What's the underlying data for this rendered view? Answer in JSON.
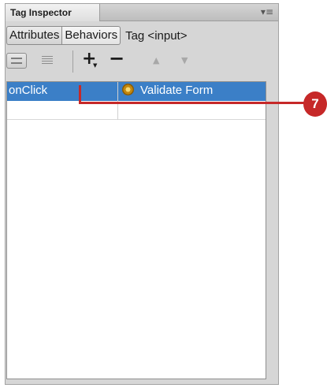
{
  "panel": {
    "title": "Tag Inspector",
    "menu_icon": "panel-options-icon"
  },
  "tabs": {
    "attributes": "Attributes",
    "behaviors": "Behaviors",
    "tag_label": "Tag <input>"
  },
  "toolbar": {
    "add_symbol": "+",
    "remove_symbol": "−",
    "up_symbol": "▲",
    "down_symbol": "▼"
  },
  "behaviors": [
    {
      "event": "onClick",
      "action": "Validate Form",
      "selected": true
    }
  ],
  "callout": {
    "number": "7"
  },
  "colors": {
    "selection": "#3b7fc7",
    "callout": "#c62828"
  }
}
